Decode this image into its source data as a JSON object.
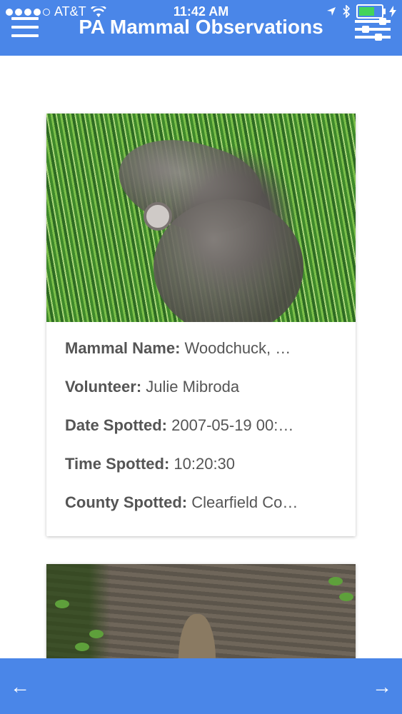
{
  "status_bar": {
    "carrier": "AT&T",
    "time": "11:42 AM",
    "signal_dots_filled": 4,
    "battery_level": 0.72
  },
  "header": {
    "title": "PA Mammal Observations",
    "menu_icon": "hamburger-menu-icon",
    "filter_icon": "sliders-icon"
  },
  "observations": [
    {
      "photo_alt": "Woodchuck in grass",
      "fields": [
        {
          "label": "Mammal Name:",
          "value": "Woodchuck, …"
        },
        {
          "label": "Volunteer:",
          "value": "Julie Mibroda"
        },
        {
          "label": "Date Spotted:",
          "value": "2007-05-19 00:…"
        },
        {
          "label": "Time Spotted:",
          "value": "10:20:30"
        },
        {
          "label": "County Spotted:",
          "value": "Clearfield Co…"
        }
      ]
    },
    {
      "photo_alt": "Animal on concrete"
    }
  ],
  "footer": {
    "prev_icon": "arrow-left-icon",
    "next_icon": "arrow-right-icon",
    "prev_label": "←",
    "next_label": "→"
  },
  "colors": {
    "accent": "#4a86e8",
    "text": "#555555",
    "battery": "#44d45a"
  }
}
